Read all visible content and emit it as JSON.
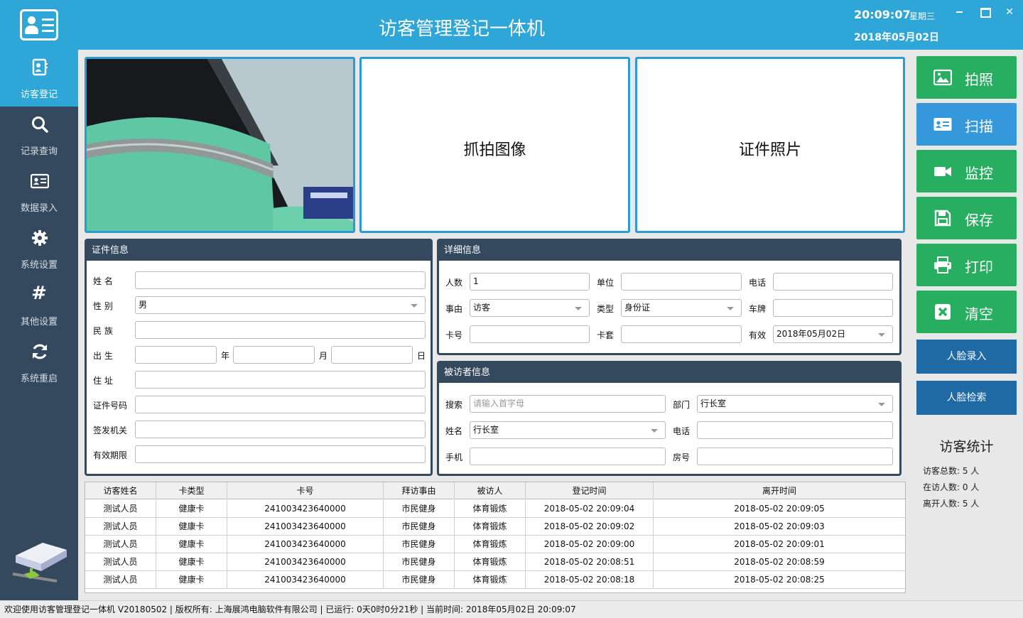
{
  "window": {
    "title": "访客管理登记一体机",
    "clock": "20:09:07",
    "weekday": "星期三",
    "date": "2018年05月02日"
  },
  "sidebar": {
    "items": [
      {
        "label": "访客登记",
        "icon": "visitor-card-icon",
        "active": true
      },
      {
        "label": "记录查询",
        "icon": "search-icon"
      },
      {
        "label": "数据录入",
        "icon": "id-card-icon"
      },
      {
        "label": "系统设置",
        "icon": "gear-icon"
      },
      {
        "label": "其他设置",
        "icon": "hash-icon"
      },
      {
        "label": "系统重启",
        "icon": "refresh-icon"
      }
    ]
  },
  "panels": {
    "capture_label": "抓拍图像",
    "id_photo_label": "证件照片"
  },
  "actions": {
    "photo": "拍照",
    "scan": "扫描",
    "monitor": "监控",
    "save": "保存",
    "print": "打印",
    "clear": "清空",
    "face_enroll": "人脸录入",
    "face_search": "人脸检索"
  },
  "stats": {
    "title": "访客统计",
    "total": "访客总数: 5 人",
    "present": "在访人数: 0 人",
    "left": "离开人数: 5 人"
  },
  "id_info": {
    "title": "证件信息",
    "name_label": "姓  名",
    "gender_label": "性  别",
    "gender_value": "男",
    "ethnicity_label": "民  族",
    "birth_label": "出  生",
    "year_label": "年",
    "month_label": "月",
    "day_label": "日",
    "address_label": "住  址",
    "id_number_label": "证件号码",
    "issuer_label": "签发机关",
    "validity_label": "有效期限"
  },
  "detail_info": {
    "title": "详细信息",
    "count_label": "人数",
    "count_value": "1",
    "unit_label": "单位",
    "phone_label": "电话",
    "reason_label": "事由",
    "reason_value": "访客",
    "type_label": "类型",
    "type_value": "身份证",
    "plate_label": "车牌",
    "card_label": "卡号",
    "sleeve_label": "卡套",
    "valid_label": "有效",
    "valid_value": "2018年05月02日"
  },
  "visitee_info": {
    "title": "被访者信息",
    "search_label": "搜索",
    "search_placeholder": "请输入首字母",
    "dept_label": "部门",
    "dept_value": "行长室",
    "name_label": "姓名",
    "name_value": "行长室",
    "phone_label": "电话",
    "mobile_label": "手机",
    "room_label": "房号"
  },
  "records": {
    "columns": [
      "访客姓名",
      "卡类型",
      "卡号",
      "拜访事由",
      "被访人",
      "登记时间",
      "离开时间"
    ],
    "rows": [
      [
        "测试人员",
        "健康卡",
        "241003423640000",
        "市民健身",
        "体育锻炼",
        "2018-05-02 20:09:04",
        "2018-05-02 20:09:05"
      ],
      [
        "测试人员",
        "健康卡",
        "241003423640000",
        "市民健身",
        "体育锻炼",
        "2018-05-02 20:09:02",
        "2018-05-02 20:09:03"
      ],
      [
        "测试人员",
        "健康卡",
        "241003423640000",
        "市民健身",
        "体育锻炼",
        "2018-05-02 20:09:00",
        "2018-05-02 20:09:01"
      ],
      [
        "测试人员",
        "健康卡",
        "241003423640000",
        "市民健身",
        "体育锻炼",
        "2018-05-02 20:08:51",
        "2018-05-02 20:08:59"
      ],
      [
        "测试人员",
        "健康卡",
        "241003423640000",
        "市民健身",
        "体育锻炼",
        "2018-05-02 20:08:18",
        "2018-05-02 20:08:25"
      ]
    ]
  },
  "status": {
    "text": "欢迎使用访客管理登记一体机 V20180502 | 版权所有: 上海展鸿电脑软件有限公司 | 已运行: 0天0时0分21秒 | 当前时间: 2018年05月02日 20:09:07"
  }
}
